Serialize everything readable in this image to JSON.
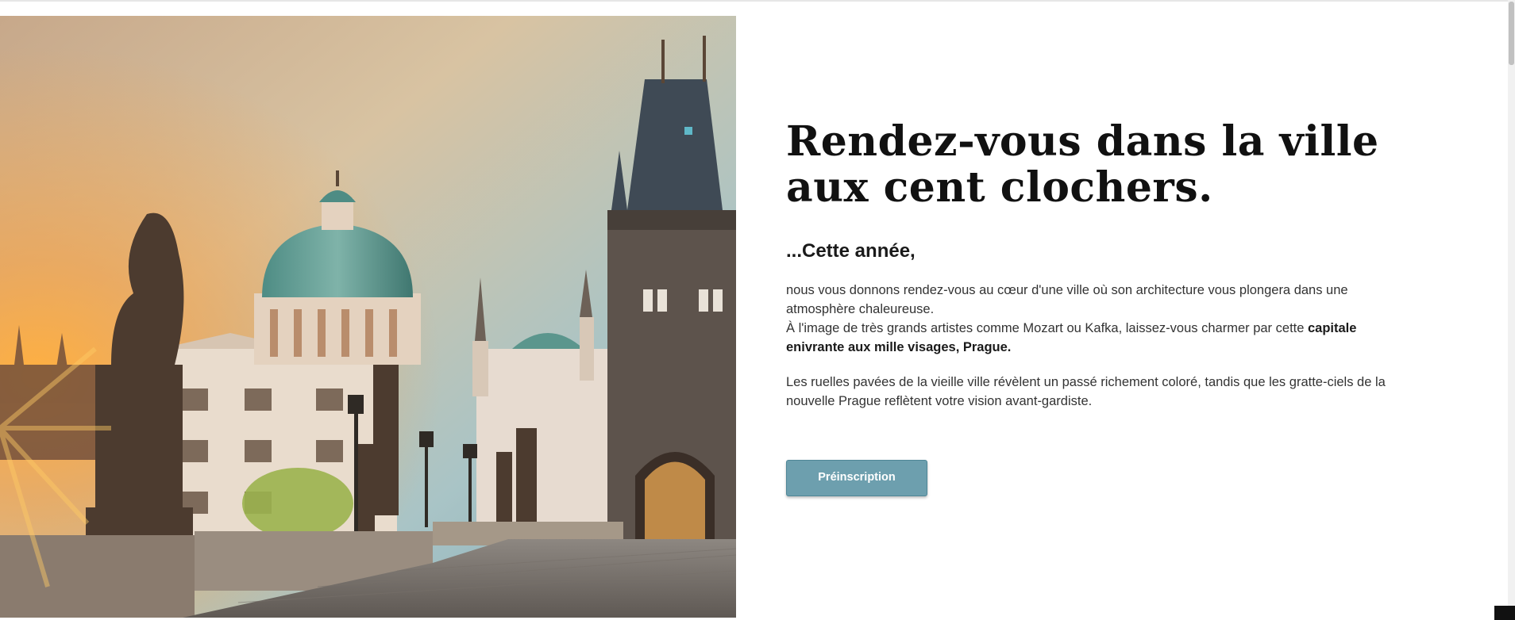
{
  "hero": {
    "image_alt": "Pont Charles et Vieille Ville de Prague au coucher du soleil"
  },
  "content": {
    "title": "Rendez-vous dans la ville aux cent clochers.",
    "subtitle": "...Cette année,",
    "paragraph1_part1": "nous vous donnons rendez-vous au cœur d'une ville où son architecture vous plongera dans une atmosphère chaleureuse.",
    "paragraph1_part2": "À l'image de très grands artistes comme Mozart ou Kafka, laissez-vous charmer par cette ",
    "paragraph1_bold": "capitale enivrante aux mille visages, Prague.",
    "paragraph2": "Les ruelles pavées de la vieille ville révèlent un passé richement coloré, tandis que les gratte-ciels de la nouvelle Prague reflètent votre vision avant-gardiste."
  },
  "cta": {
    "label": "Préinscription",
    "color": "#6d9fae"
  },
  "icons": {
    "scrollbar": "scrollbar-thumb"
  }
}
